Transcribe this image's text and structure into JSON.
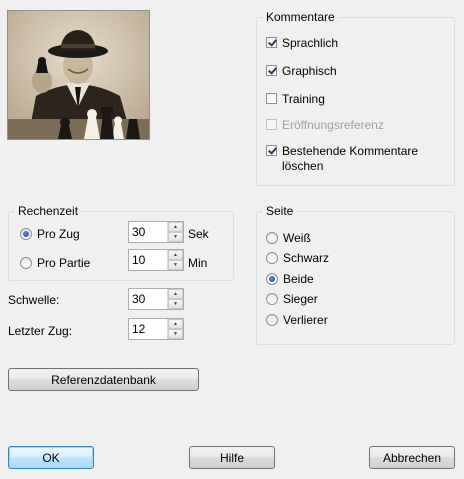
{
  "comments": {
    "title": "Kommentare",
    "items": [
      {
        "label": "Sprachlich",
        "checked": true,
        "enabled": true
      },
      {
        "label": "Graphisch",
        "checked": true,
        "enabled": true
      },
      {
        "label": "Training",
        "checked": false,
        "enabled": true
      },
      {
        "label": "Eröffnungsreferenz",
        "checked": false,
        "enabled": false
      },
      {
        "label": "Bestehende Kommentare löschen",
        "checked": true,
        "enabled": true
      }
    ]
  },
  "thinking": {
    "title": "Rechenzeit",
    "per_move": {
      "label": "Pro Zug",
      "value": "30",
      "unit": "Sek",
      "selected": true
    },
    "per_game": {
      "label": "Pro Partie",
      "value": "10",
      "unit": "Min",
      "selected": false
    }
  },
  "threshold": {
    "label": "Schwelle:",
    "value": "30"
  },
  "last_move": {
    "label": "Letzter Zug:",
    "value": "12"
  },
  "side": {
    "title": "Seite",
    "options": [
      "Weiß",
      "Schwarz",
      "Beide",
      "Sieger",
      "Verlierer"
    ],
    "selected": "Beide"
  },
  "buttons": {
    "reference_db": "Referenzdatenbank",
    "ok": "OK",
    "help": "Hilfe",
    "cancel": "Abbrechen"
  }
}
